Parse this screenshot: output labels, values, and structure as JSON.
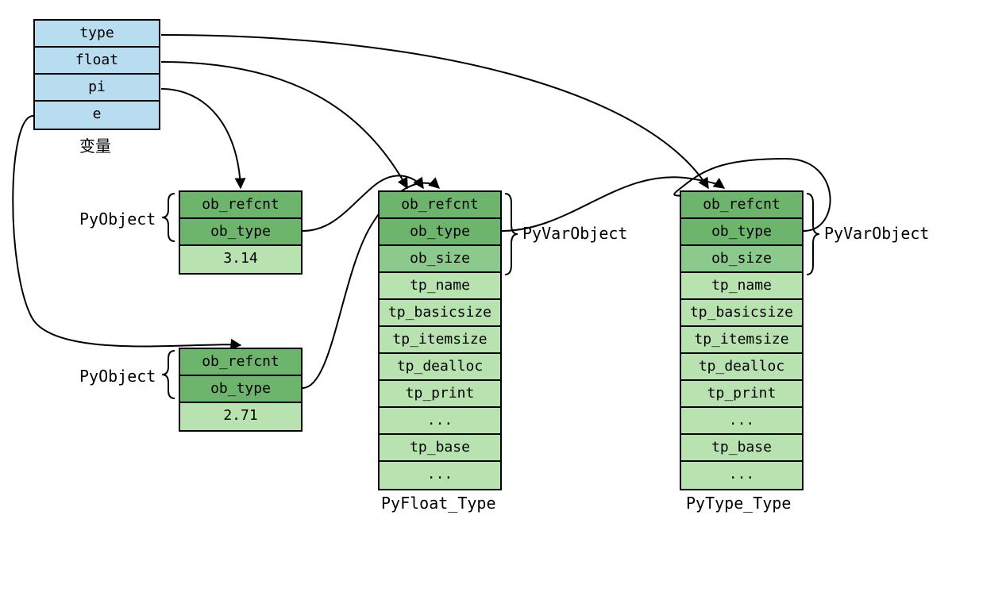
{
  "vars": {
    "label": "变量",
    "cells": [
      "type",
      "float",
      "pi",
      "e"
    ]
  },
  "obj1": {
    "label": "PyObject",
    "cells": [
      "ob_refcnt",
      "ob_type",
      "3.14"
    ]
  },
  "obj2": {
    "label": "PyObject",
    "cells": [
      "ob_refcnt",
      "ob_type",
      "2.71"
    ]
  },
  "floatType": {
    "label": "PyFloat_Type",
    "brace": "PyVarObject",
    "cells": [
      "ob_refcnt",
      "ob_type",
      "ob_size",
      "tp_name",
      "tp_basicsize",
      "tp_itemsize",
      "tp_dealloc",
      "tp_print",
      "...",
      "tp_base",
      "..."
    ]
  },
  "typeType": {
    "label": "PyType_Type",
    "brace": "PyVarObject",
    "cells": [
      "ob_refcnt",
      "ob_type",
      "ob_size",
      "tp_name",
      "tp_basicsize",
      "tp_itemsize",
      "tp_dealloc",
      "tp_print",
      "...",
      "tp_base",
      "..."
    ]
  }
}
